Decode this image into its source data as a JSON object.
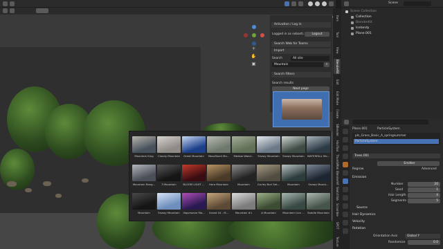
{
  "window": {
    "scene_label": "Scene"
  },
  "viewport": {
    "options_label": "Options"
  },
  "sidebar": {
    "activation_header": "Activation / Log in",
    "logged_in_text": "Logged in as sebasti...",
    "logout_label": "Logout",
    "teams_header": "Search Web for Teams",
    "import_header": "Import",
    "search_label": "Search",
    "filter_value": "All site",
    "search_value": "Mountain",
    "search_filters_label": "Search Filters",
    "results_label": "Search results",
    "next_page_label": "Next page"
  },
  "vertical_tabs": [
    "Item",
    "Tool",
    "View",
    "BlenderKit",
    "Edit",
    "Edit Mode",
    "Create",
    "SBlender",
    "HairTool",
    "ThumbMaker",
    "BlenderHF",
    "Sketchfab",
    "Scramble Tweaks",
    "SPOT",
    "Texture"
  ],
  "results": [
    {
      "caption": "Mountain King",
      "colors": [
        "#46515c",
        "#b9b5ad"
      ]
    },
    {
      "caption": "Cloudy Mountain",
      "colors": [
        "#8e8a86",
        "#d8d4cf"
      ]
    },
    {
      "caption": "Great Mountain",
      "colors": [
        "#1c3f8a",
        "#c9d8f2"
      ]
    },
    {
      "caption": "MossStock Mo...",
      "colors": [
        "#6f786d",
        "#b6bdb3"
      ]
    },
    {
      "caption": "Medow Wand...",
      "colors": [
        "#617056",
        "#a6ad9b"
      ]
    },
    {
      "caption": "Snowy Mountain",
      "colors": [
        "#6c7a88",
        "#e4e8ec"
      ]
    },
    {
      "caption": "Snowy Mountain",
      "colors": [
        "#3f4b45",
        "#cfd6d3"
      ]
    },
    {
      "caption": "WATERFALL Mo...",
      "colors": [
        "#2c3a44",
        "#a8b4bc"
      ]
    },
    {
      "caption": "Mountain Rang...",
      "colors": [
        "#4a4e57",
        "#b4b7bd"
      ]
    },
    {
      "caption": "3 Mountain",
      "colors": [
        "#151515",
        "#5a5a5a"
      ]
    },
    {
      "caption": "BLOOM LIGHT ...",
      "colors": [
        "#3a0d12",
        "#c23b2a"
      ]
    },
    {
      "caption": "Hero Mountain",
      "colors": [
        "#4a3b28",
        "#b99567"
      ]
    },
    {
      "caption": "Mountain",
      "colors": [
        "#232323",
        "#8d8d8d"
      ]
    },
    {
      "caption": "Gurley Burl Set...",
      "colors": [
        "#504c42",
        "#a79c82"
      ]
    },
    {
      "caption": "Mountain",
      "colors": [
        "#2d3c3c",
        "#b9c4c2"
      ]
    },
    {
      "caption": "Snowy Mount...",
      "colors": [
        "#1d2530",
        "#7b8896"
      ]
    },
    {
      "caption": "Mountain",
      "colors": [
        "#151515",
        "#4a4a4a"
      ]
    },
    {
      "caption": "Snowy Mountain",
      "colors": [
        "#6e8fbd",
        "#d6e4f5"
      ]
    },
    {
      "caption": "Vaporwave Mo...",
      "colors": [
        "#2b1a52",
        "#b04fb8"
      ]
    },
    {
      "caption": "Grand 04 - M...",
      "colors": [
        "#5d4a36",
        "#c5a77c"
      ]
    },
    {
      "caption": "Mountain #1",
      "colors": [
        "#7c7c7c",
        "#dcdcdc"
      ]
    },
    {
      "caption": "A Mountain",
      "colors": [
        "#3c4d33",
        "#9fb08a"
      ]
    },
    {
      "caption": "Mountain Lion ...",
      "colors": [
        "#384a43",
        "#a6b8b0"
      ]
    },
    {
      "caption": "Saddle Mountain",
      "colors": [
        "#46544a",
        "#aeb9b0"
      ]
    }
  ],
  "outliner": {
    "items": [
      {
        "label": "Scene Collection",
        "color": "#8a8a8a",
        "indent": 0
      },
      {
        "label": "Collection",
        "color": "#e0e0e0",
        "indent": 1
      },
      {
        "label": "BlenderKit",
        "color": "#8a8a8a",
        "indent": 1
      },
      {
        "label": "Icelandy",
        "color": "#e0e0e0",
        "indent": 1
      },
      {
        "label": "Plane.001",
        "color": "#e0e0e0",
        "indent": 1
      }
    ]
  },
  "properties": {
    "object_name": "Plane.001",
    "system_name": "ParticleSystem",
    "particle_list": [
      "pls_Grass_Basic_A_springsummer",
      "ParticleSystem"
    ],
    "settings_name": "Trees.001",
    "mode_regrow": "Regrow",
    "emitter_tab": "Emitter",
    "advanced_label": "Advanced",
    "emission_header": "Emission",
    "fields": [
      {
        "label": "Number",
        "value": "20"
      },
      {
        "label": "Seed",
        "value": "1"
      },
      {
        "label": "Hair Length",
        "value": "4"
      },
      {
        "label": "Segments",
        "value": "5"
      }
    ],
    "source_header": "Source",
    "hair_dynamics_header": "Hair Dynamics",
    "velocity_header": "Velocity",
    "rotation_header": "Rotation",
    "orientation_axis_label": "Orientation Axis",
    "orientation_axis_value": "Global Y",
    "randomize_label": "Randomize",
    "randomize_value": "0.0"
  }
}
